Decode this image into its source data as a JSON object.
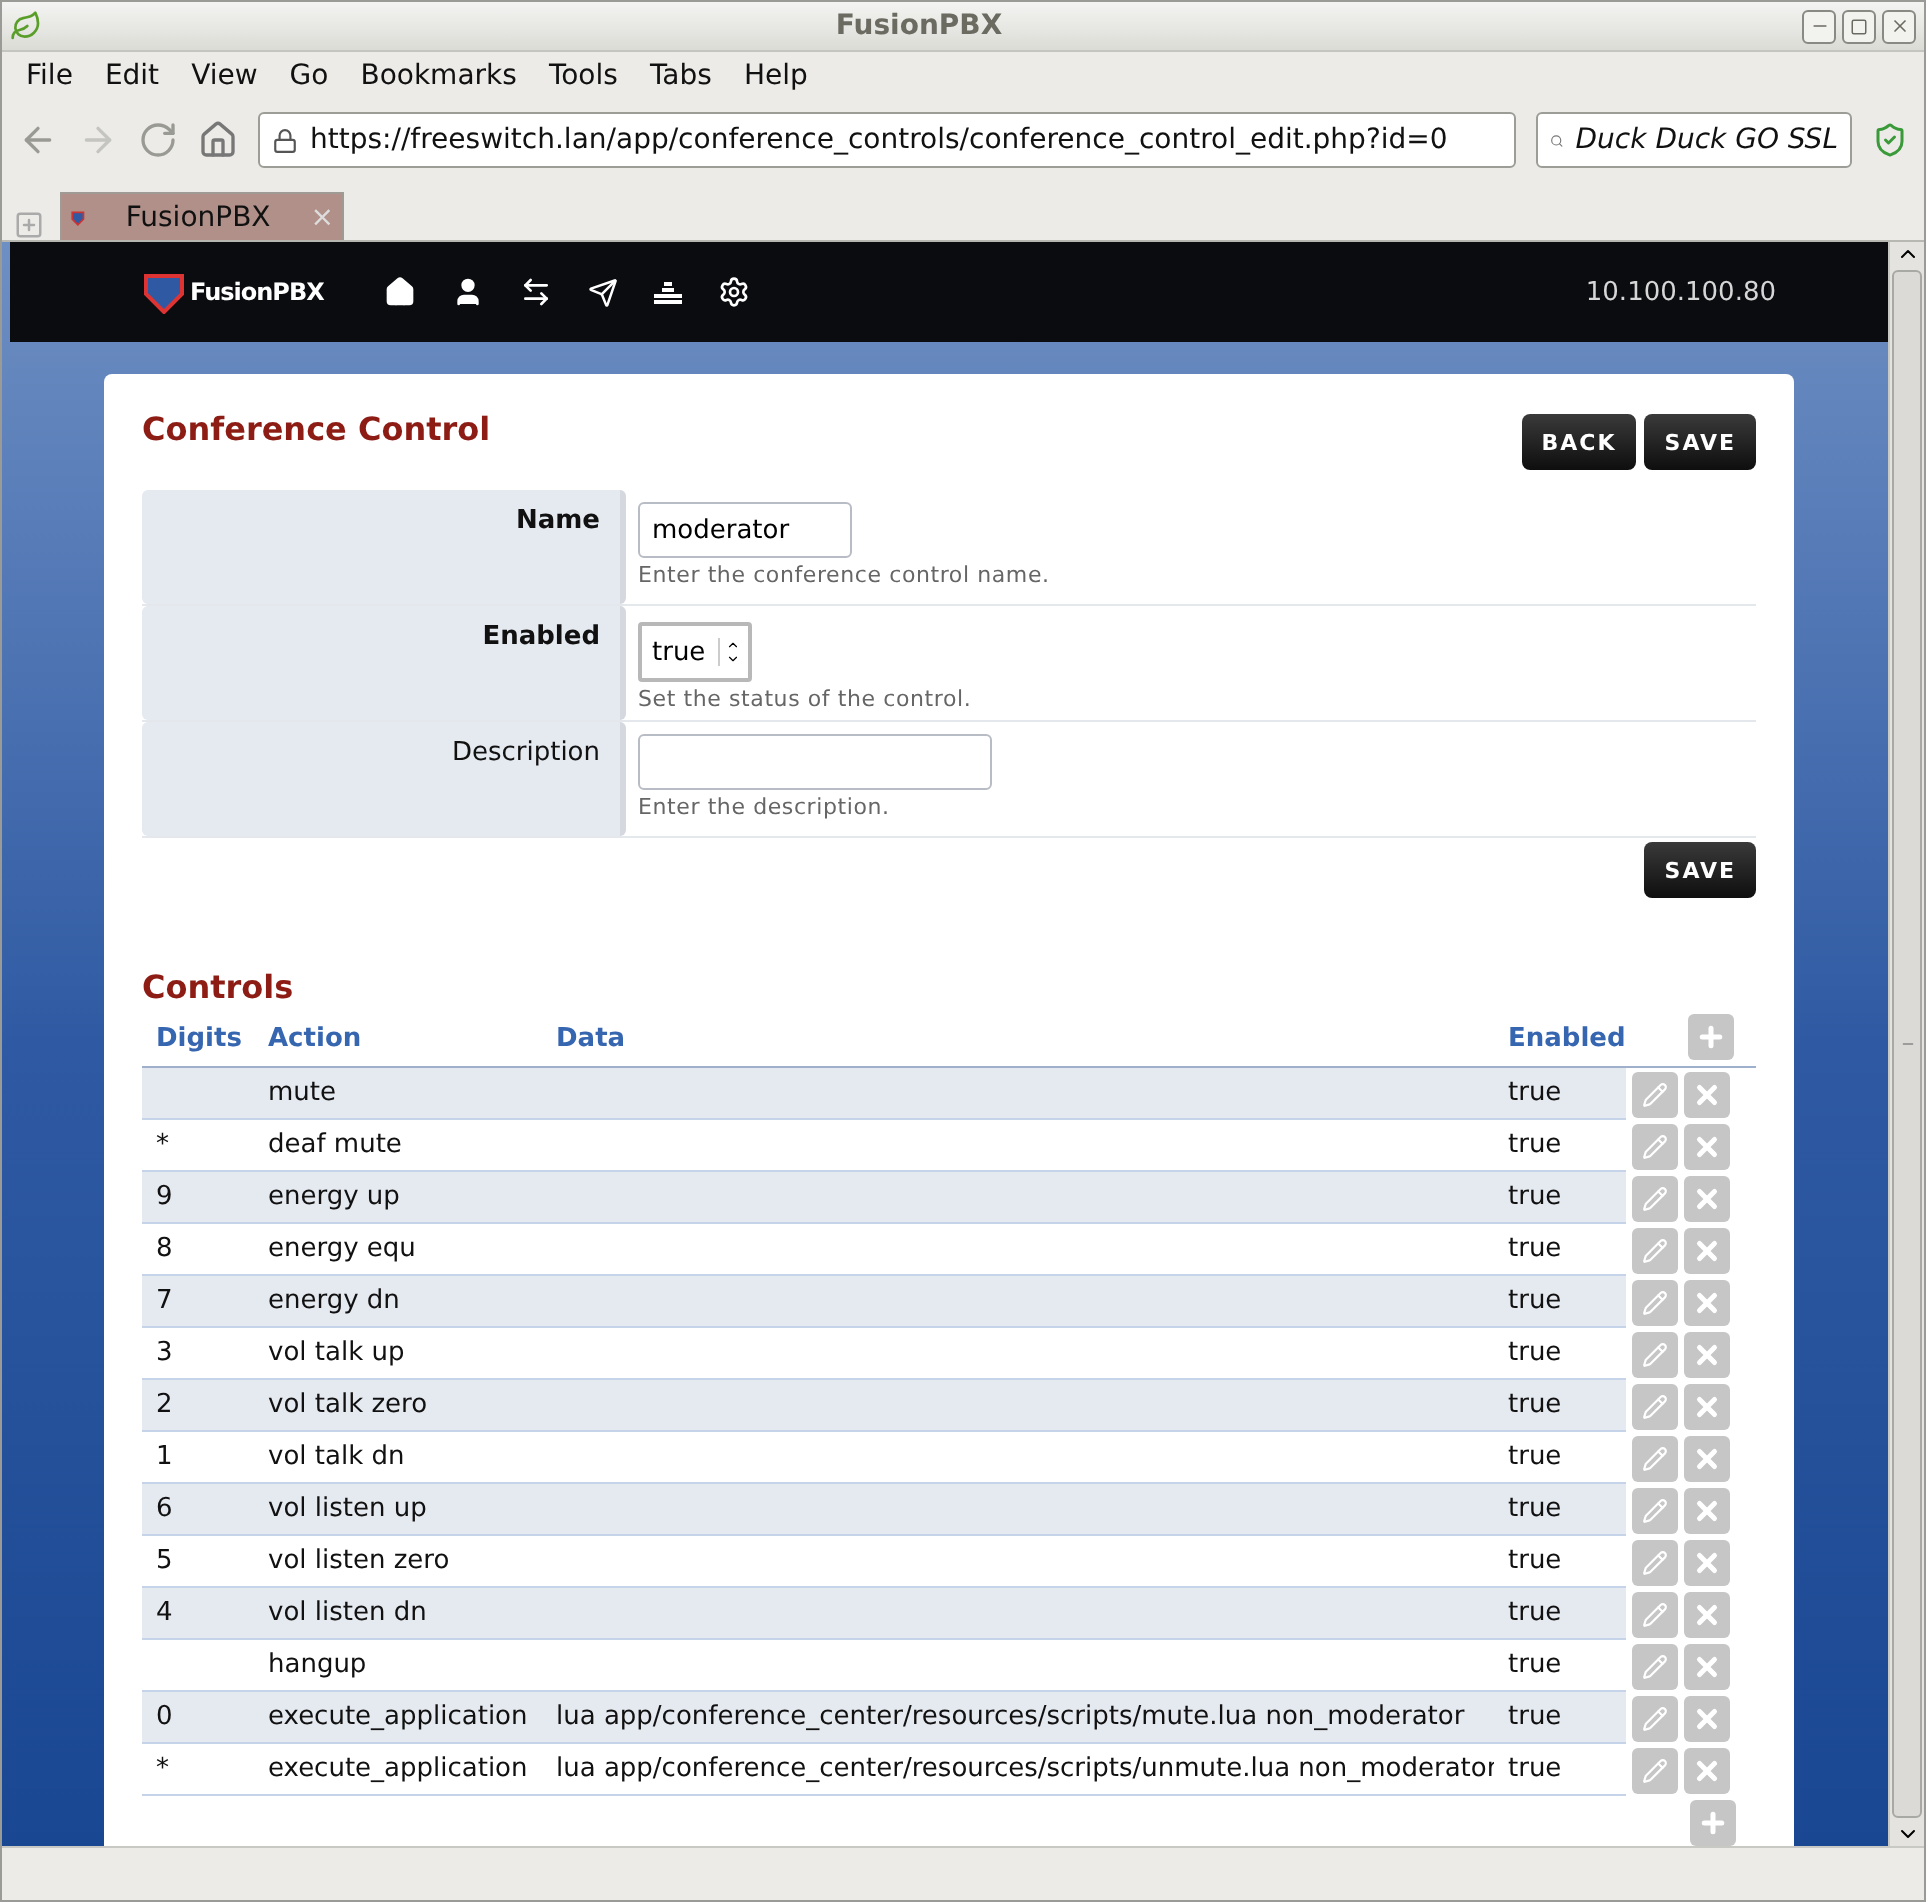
{
  "window": {
    "title": "FusionPBX"
  },
  "menu": [
    "File",
    "Edit",
    "View",
    "Go",
    "Bookmarks",
    "Tools",
    "Tabs",
    "Help"
  ],
  "toolbar": {
    "url": "https://freeswitch.lan/app/conference_controls/conference_control_edit.php?id=0",
    "search_placeholder": "Duck Duck GO SSL"
  },
  "tabs": [
    {
      "label": "FusionPBX",
      "selected": true,
      "close": "×"
    }
  ],
  "app_nav": {
    "logo": "FusionPBX",
    "address": "10.100.100.80"
  },
  "form": {
    "title": "Conference Control",
    "buttons": [
      "BACK",
      "SAVE"
    ],
    "fields": [
      {
        "kind": "text",
        "label": "Name",
        "required": true,
        "value": "moderator",
        "help": "Enter the conference control name."
      },
      {
        "kind": "select",
        "label": "Enabled",
        "required": true,
        "value": "true",
        "help": "Set the status of the control."
      },
      {
        "kind": "text",
        "label": "Description",
        "required": false,
        "help": "Enter the description."
      }
    ],
    "save_button": "SAVE"
  },
  "controls": {
    "title": "Controls",
    "columns": [
      "Digits",
      "Action",
      "Data",
      "Enabled"
    ],
    "rows": [
      {
        "action": "mute",
        "enabled": "true"
      },
      {
        "digits": "*",
        "action": "deaf mute",
        "enabled": "true"
      },
      {
        "digits": "9",
        "action": "energy up",
        "enabled": "true"
      },
      {
        "digits": "8",
        "action": "energy equ",
        "enabled": "true"
      },
      {
        "digits": "7",
        "action": "energy dn",
        "enabled": "true"
      },
      {
        "digits": "3",
        "action": "vol talk up",
        "enabled": "true"
      },
      {
        "digits": "2",
        "action": "vol talk zero",
        "enabled": "true"
      },
      {
        "digits": "1",
        "action": "vol talk dn",
        "enabled": "true"
      },
      {
        "digits": "6",
        "action": "vol listen up",
        "enabled": "true"
      },
      {
        "digits": "5",
        "action": "vol listen zero",
        "enabled": "true"
      },
      {
        "digits": "4",
        "action": "vol listen dn",
        "enabled": "true"
      },
      {
        "action": "hangup",
        "enabled": "true"
      },
      {
        "digits": "0",
        "action": "execute_application",
        "data": "lua app/conference_center/resources/scripts/mute.lua non_moderator",
        "enabled": "true"
      },
      {
        "digits": "*",
        "action": "execute_application",
        "data": "lua app/conference_center/resources/scripts/unmute.lua non_moderator",
        "enabled": "true"
      }
    ]
  }
}
